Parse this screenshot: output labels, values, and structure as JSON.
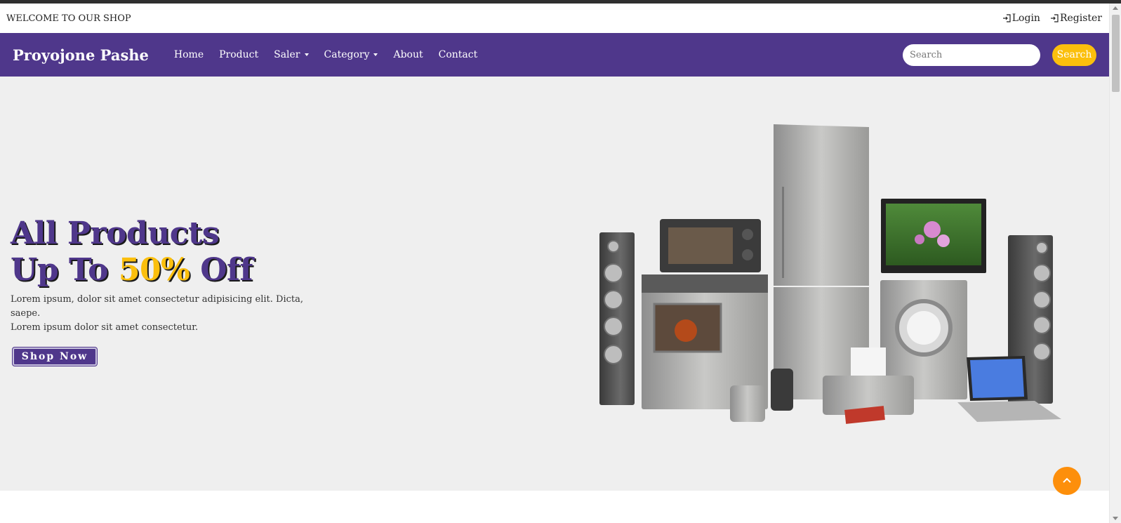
{
  "topbar": {
    "welcome": "WELCOME TO OUR SHOP",
    "login_label": "Login",
    "register_label": "Register"
  },
  "navbar": {
    "brand": "Proyojone Pashe",
    "links": [
      {
        "label": "Home",
        "dropdown": false
      },
      {
        "label": "Product",
        "dropdown": false
      },
      {
        "label": "Saler",
        "dropdown": true
      },
      {
        "label": "Category",
        "dropdown": true
      },
      {
        "label": "About",
        "dropdown": false
      },
      {
        "label": "Contact",
        "dropdown": false
      }
    ],
    "search_placeholder": "Search",
    "search_button": "Search"
  },
  "hero": {
    "title_line1": "All Products",
    "title_line2_prefix": "Up To",
    "title_line2_accent": "50%",
    "title_line2_suffix": "Off",
    "desc_line1": "Lorem ipsum, dolor sit amet consectetur adipisicing elit. Dicta, saepe.",
    "desc_line2": "Lorem ipsum dolor sit amet consectetur.",
    "cta": "Shop Now"
  },
  "icons": {
    "login": "login-icon",
    "register": "login-icon",
    "back_to_top": "chevron-up-icon"
  },
  "colors": {
    "brand_purple": "#4f378b",
    "accent_yellow": "#fbbf0d",
    "back_to_top_orange": "#fd8f0b",
    "hero_background": "#efefef"
  }
}
